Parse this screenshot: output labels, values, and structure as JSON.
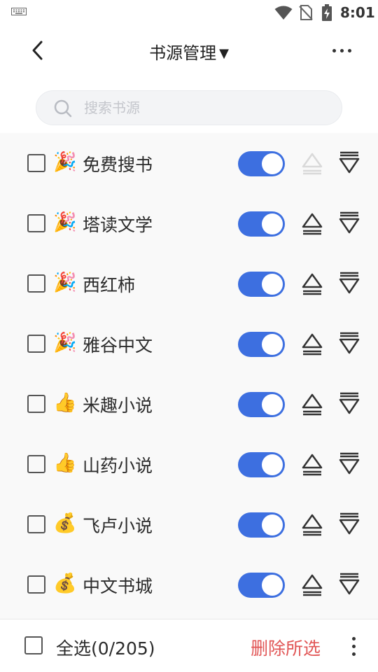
{
  "status_bar": {
    "time": "8:01"
  },
  "header": {
    "title": "书源管理",
    "caret": "▼"
  },
  "search": {
    "placeholder": "搜索书源",
    "value": ""
  },
  "sources": [
    {
      "emoji": "🎉",
      "name": "免费搜书",
      "enabled": true,
      "checked": false,
      "up_disabled": true
    },
    {
      "emoji": "🎉",
      "name": "塔读文学",
      "enabled": true,
      "checked": false,
      "up_disabled": false
    },
    {
      "emoji": "🎉",
      "name": "西红柿",
      "enabled": true,
      "checked": false,
      "up_disabled": false
    },
    {
      "emoji": "🎉",
      "name": "雅谷中文",
      "enabled": true,
      "checked": false,
      "up_disabled": false
    },
    {
      "emoji": "👍",
      "name": "米趣小说",
      "enabled": true,
      "checked": false,
      "up_disabled": false
    },
    {
      "emoji": "👍",
      "name": "山药小说",
      "enabled": true,
      "checked": false,
      "up_disabled": false
    },
    {
      "emoji": "💰",
      "name": "飞卢小说",
      "enabled": true,
      "checked": false,
      "up_disabled": false
    },
    {
      "emoji": "💰",
      "name": "中文书城",
      "enabled": true,
      "checked": false,
      "up_disabled": false
    }
  ],
  "footer": {
    "select_all_label": "全选(0/205)",
    "delete_label": "删除所选"
  },
  "colors": {
    "accent": "#3d6fe0",
    "danger": "#e15656"
  }
}
